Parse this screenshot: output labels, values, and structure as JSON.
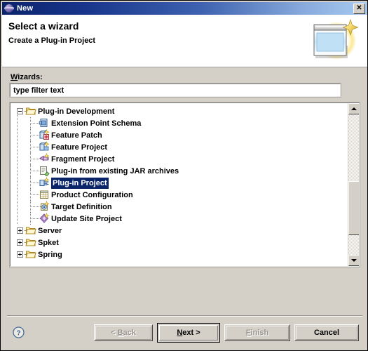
{
  "window": {
    "title": "New",
    "title_icon": "eclipse-sphere-icon",
    "close_label": "✕",
    "close_icon": "close-icon"
  },
  "header": {
    "title": "Select a wizard",
    "subtitle": "Create a Plug-in Project",
    "banner_icon": "new-wizard-banner-icon"
  },
  "form": {
    "wizards_label_mnemonic": "W",
    "wizards_label_rest": "izards:",
    "filter_value": "type filter text",
    "filter_placeholder": "type filter text"
  },
  "tree": {
    "items": [
      {
        "label": "Plug-in Development",
        "icon": "folder-open-icon",
        "level": 0,
        "expandable": true,
        "expanded": true,
        "selected": false
      },
      {
        "label": "Extension Point Schema",
        "icon": "extension-point-schema-icon",
        "level": 1,
        "expandable": false,
        "expanded": false,
        "selected": false
      },
      {
        "label": "Feature Patch",
        "icon": "feature-patch-icon",
        "level": 1,
        "expandable": false,
        "expanded": false,
        "selected": false
      },
      {
        "label": "Feature Project",
        "icon": "feature-project-icon",
        "level": 1,
        "expandable": false,
        "expanded": false,
        "selected": false
      },
      {
        "label": "Fragment Project",
        "icon": "fragment-project-icon",
        "level": 1,
        "expandable": false,
        "expanded": false,
        "selected": false
      },
      {
        "label": "Plug-in from existing JAR archives",
        "icon": "plugin-from-jar-icon",
        "level": 1,
        "expandable": false,
        "expanded": false,
        "selected": false
      },
      {
        "label": "Plug-in Project",
        "icon": "plugin-project-icon",
        "level": 1,
        "expandable": false,
        "expanded": false,
        "selected": true
      },
      {
        "label": "Product Configuration",
        "icon": "product-configuration-icon",
        "level": 1,
        "expandable": false,
        "expanded": false,
        "selected": false
      },
      {
        "label": "Target Definition",
        "icon": "target-definition-icon",
        "level": 1,
        "expandable": false,
        "expanded": false,
        "selected": false
      },
      {
        "label": "Update Site Project",
        "icon": "update-site-project-icon",
        "level": 1,
        "expandable": false,
        "expanded": false,
        "selected": false
      },
      {
        "label": "Server",
        "icon": "folder-open-icon",
        "level": 0,
        "expandable": true,
        "expanded": false,
        "selected": false
      },
      {
        "label": "Spket",
        "icon": "folder-open-icon",
        "level": 0,
        "expandable": true,
        "expanded": false,
        "selected": false
      },
      {
        "label": "Spring",
        "icon": "folder-open-icon",
        "level": 0,
        "expandable": true,
        "expanded": false,
        "selected": false
      }
    ],
    "scrollbar": {
      "up_arrow": "scroll-up-icon",
      "down_arrow": "scroll-down-icon"
    }
  },
  "footer": {
    "help_icon": "help-question-icon",
    "buttons": [
      {
        "id": "back",
        "prefix": "< ",
        "mnemonic": "B",
        "suffix": "ack",
        "disabled": true,
        "default": false
      },
      {
        "id": "next",
        "prefix": "",
        "mnemonic": "N",
        "suffix": "ext >",
        "disabled": false,
        "default": true
      },
      {
        "id": "finish",
        "prefix": "",
        "mnemonic": "F",
        "suffix": "inish",
        "disabled": true,
        "default": false
      },
      {
        "id": "cancel",
        "prefix": "",
        "mnemonic": "",
        "suffix": "Cancel",
        "disabled": false,
        "default": false
      }
    ]
  },
  "colors": {
    "title_gradient_start": "#0a246a",
    "title_gradient_end": "#a6caf0",
    "dialog_bg": "#d4d0c8",
    "selection_bg": "#0a246a",
    "selection_fg": "#ffffff",
    "list_bg": "#ffffff"
  }
}
